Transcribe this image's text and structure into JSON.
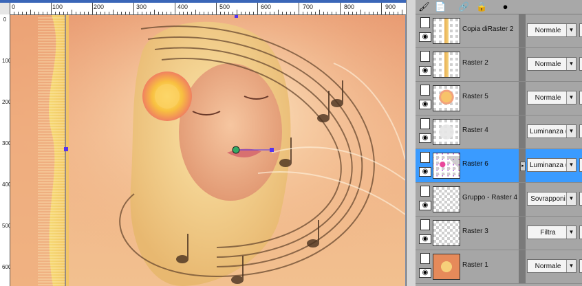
{
  "ruler": {
    "top_ticks": [
      "0",
      "100",
      "200",
      "300",
      "400",
      "500",
      "600",
      "700",
      "800",
      "900"
    ],
    "left_ticks": [
      "0",
      "100",
      "200",
      "300",
      "400",
      "500",
      "600"
    ]
  },
  "layers": [
    {
      "name": "Copia diRaster 2",
      "blend": "Normale",
      "selected": false,
      "thumb": "strip"
    },
    {
      "name": "Raster 2",
      "blend": "Normale",
      "selected": false,
      "thumb": "strip"
    },
    {
      "name": "Raster 5",
      "blend": "Normale",
      "selected": false,
      "thumb": "flower"
    },
    {
      "name": "Raster 4",
      "blend": "Luminanza (e)",
      "selected": false,
      "thumb": "faint"
    },
    {
      "name": "Raster 6",
      "blend": "Luminanza (e)",
      "selected": true,
      "thumb": "pink"
    },
    {
      "name": "Gruppo - Raster 4",
      "blend": "Sovrapponi",
      "selected": false,
      "thumb": "empty"
    },
    {
      "name": "Raster 3",
      "blend": "Filtra",
      "selected": false,
      "thumb": "empty"
    },
    {
      "name": "Raster 1",
      "blend": "Normale",
      "selected": false,
      "thumb": "orange"
    }
  ],
  "toolbar": {
    "icons": [
      "brush-icon",
      "document-icon",
      "link-icon",
      "lock-icon",
      "mask-icon"
    ]
  },
  "colors": {
    "selected_row": "#3a9bff",
    "canvas_bg": "#7d8da8",
    "image_base": "#e89a72"
  }
}
